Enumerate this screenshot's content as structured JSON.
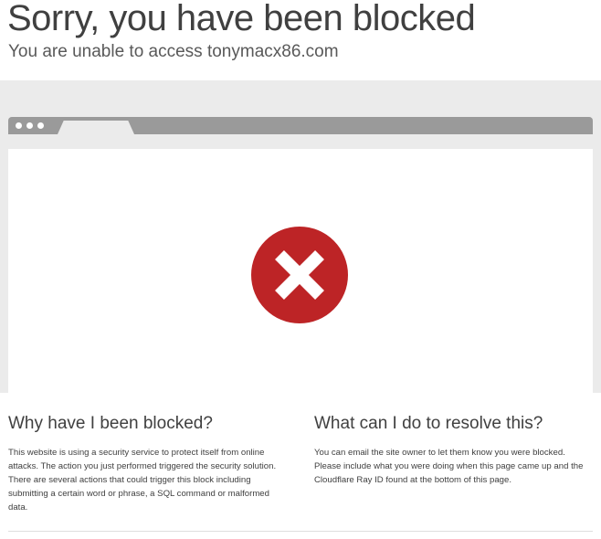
{
  "header": {
    "title": "Sorry, you have been blocked",
    "subtitle": "You are unable to access tonymacx86.com"
  },
  "illustration": {
    "window_dots": [
      "dot",
      "dot",
      "dot"
    ],
    "status_icon": "error-x-circle-icon",
    "icon_color": "#bd2426"
  },
  "sections": {
    "why": {
      "heading": "Why have I been blocked?",
      "body": "This website is using a security service to protect itself from online attacks. The action you just performed triggered the security solution. There are several actions that could trigger this block including submitting a certain word or phrase, a SQL command or malformed data."
    },
    "resolve": {
      "heading": "What can I do to resolve this?",
      "body": "You can email the site owner to let them know you were blocked. Please include what you were doing when this page came up and the Cloudflare Ray ID found at the bottom of this page."
    }
  }
}
